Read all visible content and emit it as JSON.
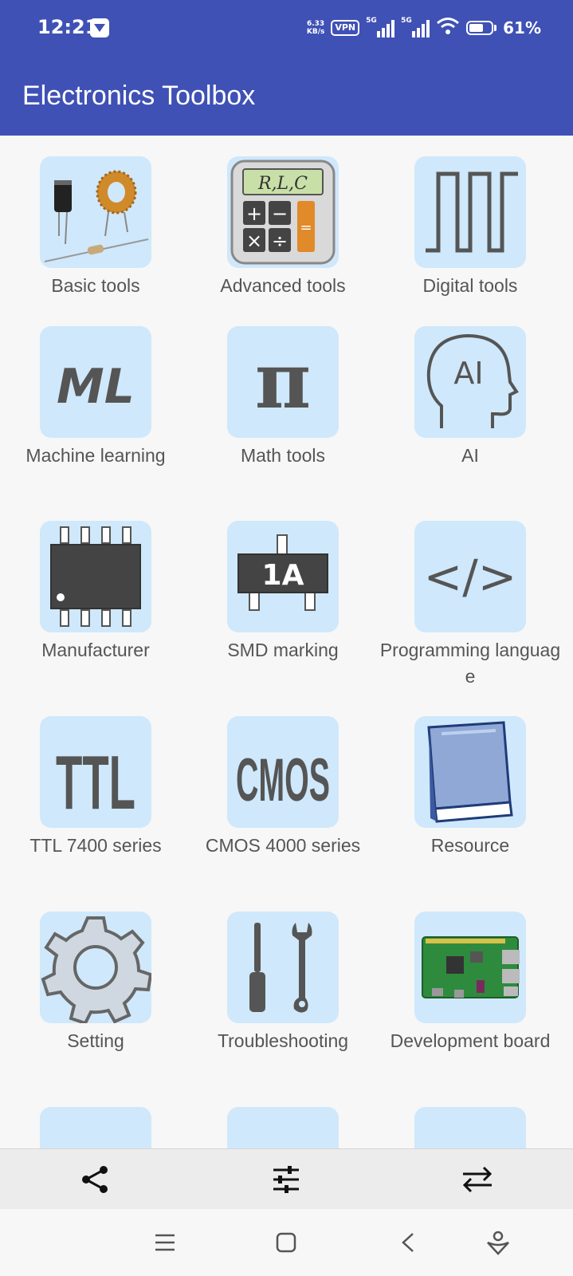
{
  "status_bar": {
    "time": "12:21",
    "net_speed_value": "6.33",
    "net_speed_unit": "KB/s",
    "vpn": "VPN",
    "sig1_label": "5G",
    "sig2_label": "5G",
    "battery": "61%"
  },
  "app_bar": {
    "title": "Electronics Toolbox"
  },
  "tiles": [
    {
      "label": "Basic tools",
      "icon": "components-icon"
    },
    {
      "label": "Advanced tools",
      "icon": "calculator-icon",
      "lcd": "R,L,C"
    },
    {
      "label": "Digital tools",
      "icon": "square-wave-icon"
    },
    {
      "label": "Machine learning",
      "icon": "ml-icon",
      "text": "ML"
    },
    {
      "label": "Math tools",
      "icon": "pi-icon",
      "text": "π"
    },
    {
      "label": "AI",
      "icon": "ai-head-icon",
      "text": "AI"
    },
    {
      "label": "Manufacturer",
      "icon": "chip-icon"
    },
    {
      "label": "SMD marking",
      "icon": "smd-icon",
      "text": "1A"
    },
    {
      "label": "Programming language",
      "icon": "code-icon",
      "text": "</>"
    },
    {
      "label": "TTL 7400 series",
      "icon": "ttl-icon",
      "text": "TTL"
    },
    {
      "label": "CMOS 4000 series",
      "icon": "cmos-icon",
      "text": "CMOS"
    },
    {
      "label": "Resource",
      "icon": "book-icon"
    },
    {
      "label": "Setting",
      "icon": "gear-icon"
    },
    {
      "label": "Troubleshooting",
      "icon": "tools-icon"
    },
    {
      "label": "Development board",
      "icon": "dev-board-icon"
    }
  ],
  "bottom_bar": {
    "share": "share-icon",
    "tune": "tune-icon",
    "swap": "swap-icon"
  },
  "colors": {
    "app_bar": "#3f51b5",
    "tile_bg": "#cfe8fb",
    "icon_grey": "#555555"
  }
}
